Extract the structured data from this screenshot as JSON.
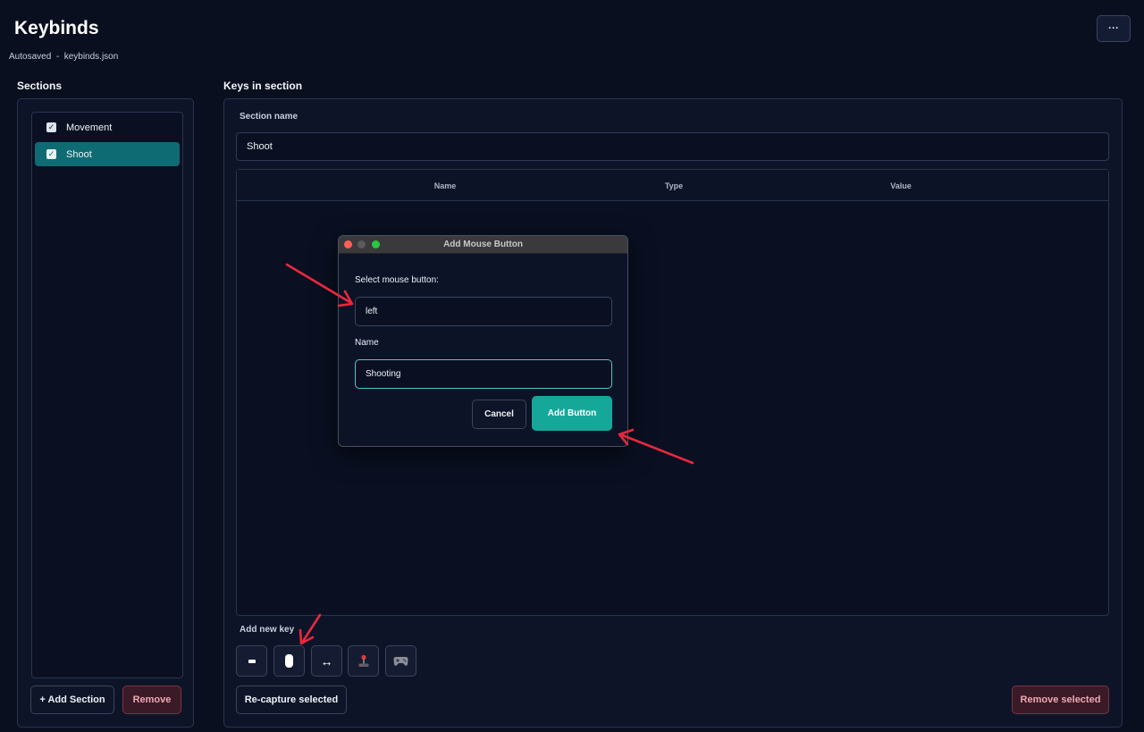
{
  "header": {
    "title": "Keybinds",
    "subtitle": "Autosaved  -  keybinds.json",
    "more_label": "···"
  },
  "sections_panel": {
    "heading": "Sections",
    "items": [
      {
        "label": "Movement",
        "checked": true,
        "selected": false
      },
      {
        "label": "Shoot",
        "checked": true,
        "selected": true
      }
    ],
    "add_label": "+ Add Section",
    "remove_label": "Remove"
  },
  "keys_panel": {
    "heading": "Keys in section",
    "section_name_label": "Section name",
    "section_name_value": "Shoot",
    "columns": [
      "Name",
      "Type",
      "Value"
    ],
    "add_new_key_label": "Add new key",
    "key_type_buttons": [
      {
        "icon": "keyboard-key-icon",
        "glyph": "▬"
      },
      {
        "icon": "mouse-icon",
        "glyph": ""
      },
      {
        "icon": "axis-icon",
        "glyph": "↔"
      },
      {
        "icon": "joystick-icon",
        "glyph": "🕹"
      },
      {
        "icon": "gamepad-icon",
        "glyph": "🎮"
      }
    ],
    "recapture_label": "Re-capture selected",
    "remove_selected_label": "Remove selected"
  },
  "modal": {
    "title": "Add Mouse Button",
    "select_label": "Select mouse button:",
    "select_value": "left",
    "name_label": "Name",
    "name_value": "Shooting",
    "cancel_label": "Cancel",
    "confirm_label": "Add Button"
  },
  "colors": {
    "accent": "#15a899",
    "selected_section": "#0f6b73",
    "danger": "#f0a6b2",
    "annotation": "#e8283c"
  }
}
